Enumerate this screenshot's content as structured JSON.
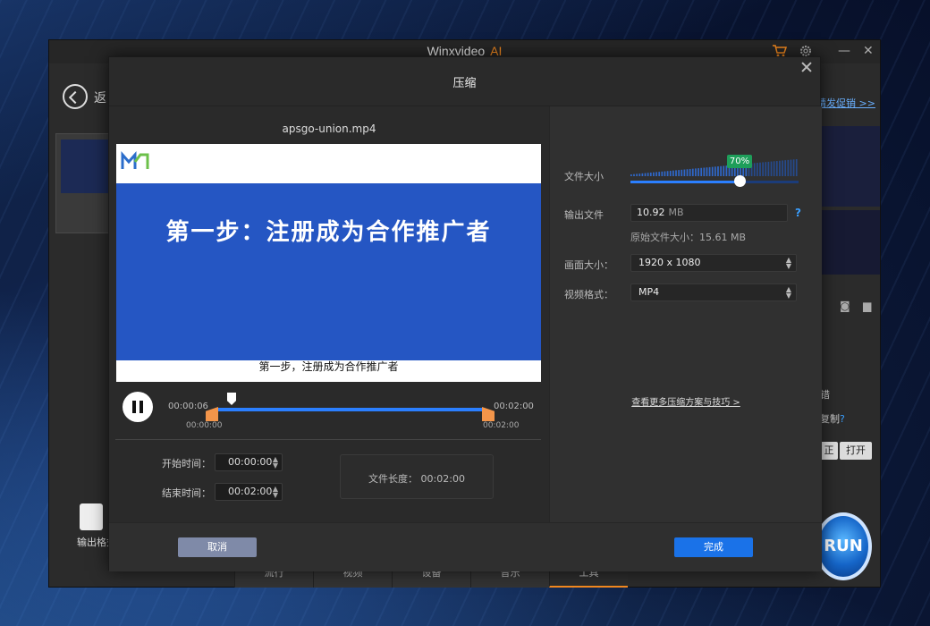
{
  "app": {
    "title": "Winxvideo",
    "title_ai": "AI",
    "back_label": "返",
    "promo_link": "精发促销 >>",
    "output_format_label": "输出格式",
    "side_text_1": "错",
    "side_text_2": "复制",
    "side_help": "?",
    "side_btn_left": "正",
    "side_btn_open": "打开",
    "run_label": "RUN",
    "bottom_tabs": [
      "流行",
      "视频",
      "设备",
      "音乐",
      "工具"
    ],
    "minimize": "—",
    "close": "✕",
    "colors": {
      "accent": "#f58a1f",
      "primary": "#1a72e8",
      "success": "#1e9e5a"
    }
  },
  "dialog": {
    "title": "压缩",
    "file_name": "apsgo-union.mp4",
    "video": {
      "headline": "第一步：注册成为合作推广者",
      "subtitle": "第一步，注册成为合作推广者"
    },
    "player": {
      "current_time": "00:00:06",
      "total_time": "00:02:00",
      "trim_start_label": "00:00:00",
      "trim_end_label": "00:02:00",
      "progress_fraction": 0.05
    },
    "start_time_label": "开始时间：",
    "start_time_value": "00:00:00",
    "end_time_label": "结束时间：",
    "end_time_value": "00:02:00",
    "duration_text": "文件长度：  00:02:00",
    "settings": {
      "file_size_label": "文件大小",
      "file_size_percent": "70%",
      "output_file_label": "输出文件",
      "output_size_value": "10.92",
      "output_size_unit": "MB",
      "help": "?",
      "original_size": "原始文件大小：15.61 MB",
      "resolution_label": "画面大小：",
      "resolution_value": "1920 x 1080",
      "format_label": "视频格式：",
      "format_value": "MP4",
      "tips_link": "查看更多压缩方案与技巧 >"
    },
    "cancel_label": "取消",
    "done_label": "完成"
  }
}
